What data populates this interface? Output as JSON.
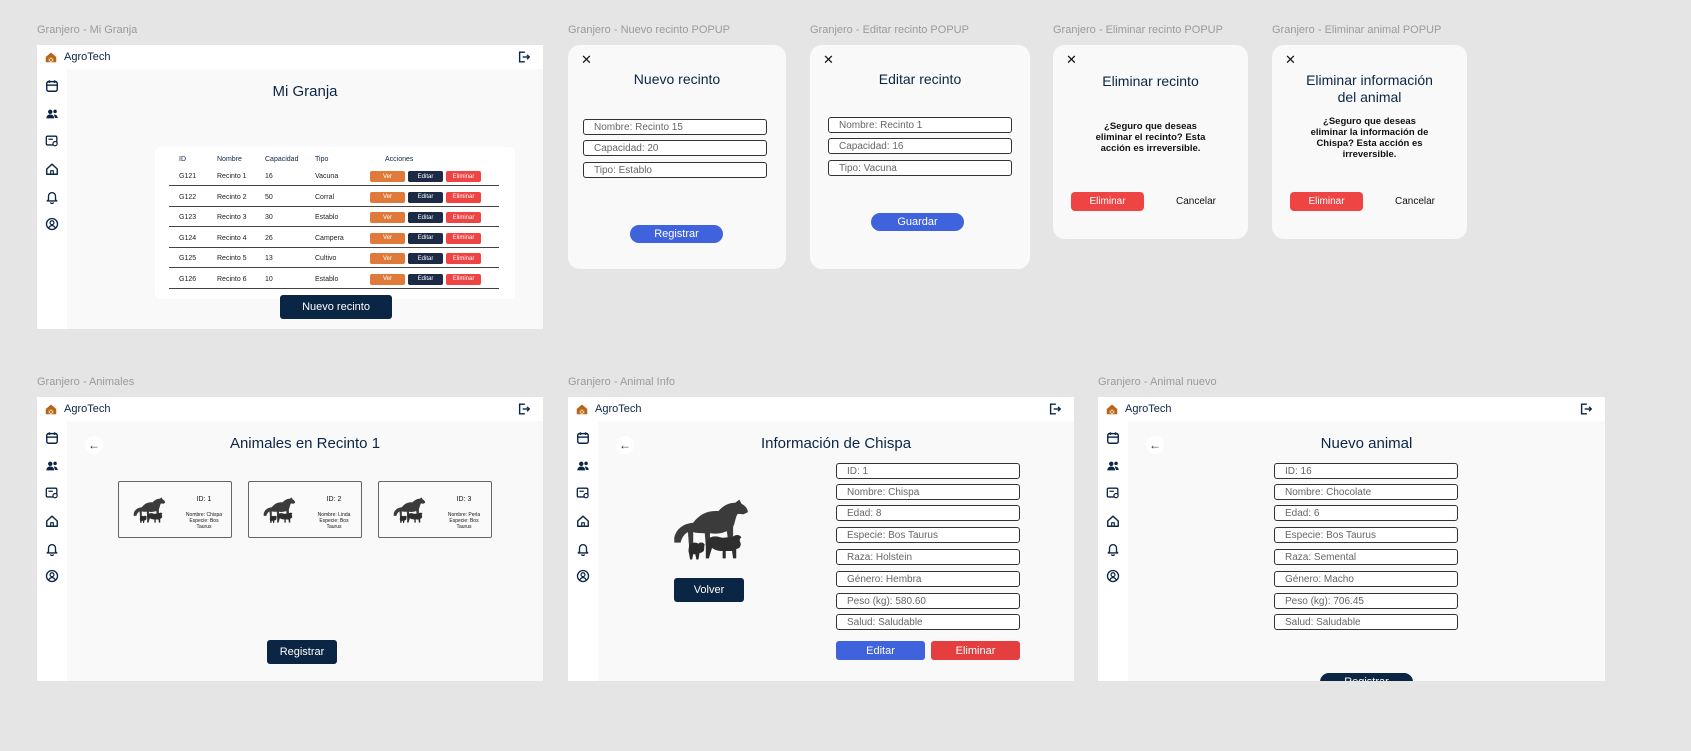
{
  "labels": {
    "mi_granja": "Granjero - Mi Granja",
    "nuevo_recinto": "Granjero - Nuevo recinto POPUP",
    "editar_recinto": "Granjero - Editar recinto POPUP",
    "eliminar_recinto": "Granjero - Eliminar recinto POPUP",
    "eliminar_animal": "Granjero - Eliminar animal POPUP",
    "animales": "Granjero - Animales",
    "animal_info": "Granjero - Animal Info",
    "animal_nuevo": "Granjero - Animal nuevo"
  },
  "app": {
    "brand": "AgroTech"
  },
  "icons": {
    "sidebar": [
      "calendar-icon",
      "users-icon",
      "certificate-icon",
      "home-icon",
      "bell-icon",
      "user-circle-icon"
    ],
    "logout": "logout-icon",
    "logo": "farm-logo-icon"
  },
  "colors": {
    "primary": "#0b2545",
    "accent_blue": "#3f63dd",
    "danger": "#ef4444",
    "orange": "#e07a3a"
  },
  "mi_granja": {
    "title": "Mi Granja",
    "headers": [
      "ID",
      "Nombre",
      "Capacidad",
      "Tipo",
      "Acciones"
    ],
    "rows": [
      [
        "G121",
        "Recinto 1",
        "16",
        "Vacuna"
      ],
      [
        "G122",
        "Recinto 2",
        "50",
        "Corral"
      ],
      [
        "G123",
        "Recinto 3",
        "30",
        "Establo"
      ],
      [
        "G124",
        "Recinto 4",
        "26",
        "Campera"
      ],
      [
        "G125",
        "Recinto 5",
        "13",
        "Cultivo"
      ],
      [
        "G126",
        "Recinto 6",
        "10",
        "Establo"
      ]
    ],
    "actions": {
      "ver": "Ver",
      "editar": "Editar",
      "eliminar": "Eliminar"
    },
    "new_button": "Nuevo recinto"
  },
  "nuevo_recinto": {
    "close": "✕",
    "title": "Nuevo recinto",
    "fields": [
      "Nombre: Recinto 15",
      "Capacidad: 20",
      "Tipo: Establo"
    ],
    "button": "Registrar"
  },
  "editar_recinto": {
    "close": "✕",
    "title": "Editar recinto",
    "fields": [
      "Nombre: Recinto 1",
      "Capacidad: 16",
      "Tipo: Vacuna"
    ],
    "button": "Guardar"
  },
  "eliminar_recinto": {
    "close": "✕",
    "title": "Eliminar recinto",
    "message_lines": [
      "¿Seguro que deseas",
      "eliminar el recinto? Esta",
      "acción es irreversible."
    ],
    "confirm": "Eliminar",
    "cancel": "Cancelar"
  },
  "eliminar_animal": {
    "close": "✕",
    "title_lines": [
      "Eliminar información",
      "del animal"
    ],
    "message_lines": [
      "¿Seguro que deseas",
      "eliminar la información de",
      "Chispa? Esta acción es",
      "irreversible."
    ],
    "confirm": "Eliminar",
    "cancel": "Cancelar"
  },
  "animales": {
    "title": "Animales en Recinto 1",
    "back": "←",
    "cards": [
      {
        "id": "ID: 1",
        "lines": [
          "Nombre: Chispa",
          "Especie: Bos",
          "Taurus"
        ]
      },
      {
        "id": "ID: 2",
        "lines": [
          "Nombre: Linda",
          "Especie: Bos",
          "Taurus"
        ]
      },
      {
        "id": "ID: 3",
        "lines": [
          "Nombre: Perla",
          "Especie: Bos",
          "Taurus"
        ]
      }
    ],
    "button": "Registrar"
  },
  "animal_info": {
    "title": "Información de Chispa",
    "back": "←",
    "fields": [
      "ID: 1",
      "Nombre: Chispa",
      "Edad: 8",
      "Especie: Bos Taurus",
      "Raza: Holstein",
      "Género: Hembra",
      "Peso (kg): 580.60",
      "Salud: Saludable"
    ],
    "volver": "Volver",
    "editar": "Editar",
    "eliminar": "Eliminar"
  },
  "animal_nuevo": {
    "title": "Nuevo animal",
    "back": "←",
    "fields": [
      "ID: 16",
      "Nombre: Chocolate",
      "Edad: 6",
      "Especie: Bos Taurus",
      "Raza: Semental",
      "Género: Macho",
      "Peso (kg): 706.45",
      "Salud: Saludable"
    ],
    "button": "Registrar"
  }
}
